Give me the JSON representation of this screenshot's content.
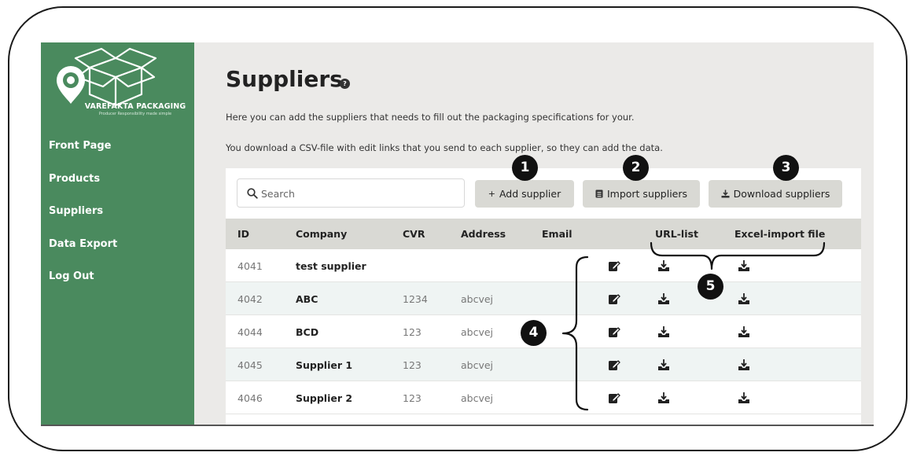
{
  "app": {
    "brand_name": "VAREFAKTA PACKAGING",
    "brand_tagline": "Producer Responsibility made simple"
  },
  "sidebar": {
    "items": [
      {
        "label": "Front Page"
      },
      {
        "label": "Products"
      },
      {
        "label": "Suppliers"
      },
      {
        "label": "Data Export"
      },
      {
        "label": "Log Out"
      }
    ]
  },
  "page": {
    "title": "Suppliers",
    "help": "?",
    "intro_1": "Here you can add the suppliers that needs to fill out the packaging specifications for your.",
    "intro_2": "You download a CSV-file with edit links that you send to each supplier, so they can add the data."
  },
  "toolbar": {
    "search_placeholder": "Search",
    "add_label": "Add supplier",
    "import_label": "Import suppliers",
    "download_label": "Download suppliers"
  },
  "table": {
    "columns": [
      "ID",
      "Company",
      "CVR",
      "Address",
      "Email",
      "URL-list",
      "Excel-import file"
    ],
    "rows": [
      {
        "id": "4041",
        "company": "test supplier",
        "cvr": "",
        "address": "",
        "email": ""
      },
      {
        "id": "4042",
        "company": "ABC",
        "cvr": "1234",
        "address": "abcvej",
        "email": ""
      },
      {
        "id": "4044",
        "company": "BCD",
        "cvr": "123",
        "address": "abcvej",
        "email": ""
      },
      {
        "id": "4045",
        "company": "Supplier 1",
        "cvr": "123",
        "address": "abcvej",
        "email": ""
      },
      {
        "id": "4046",
        "company": "Supplier 2",
        "cvr": "123",
        "address": "abcvej",
        "email": ""
      }
    ]
  },
  "annotations": {
    "markers": [
      "1",
      "2",
      "3",
      "4",
      "5"
    ]
  },
  "colors": {
    "sidebar": "#4a8a5e",
    "background": "#ebeae8",
    "button": "#d9d9d4",
    "header": "#d9d9d4",
    "alt_row": "#eff4f3"
  },
  "icons": {
    "search": "search-icon",
    "add": "plus-icon",
    "import": "import-icon",
    "download": "download-icon",
    "edit": "edit-icon",
    "row_download": "download-tray-icon"
  }
}
